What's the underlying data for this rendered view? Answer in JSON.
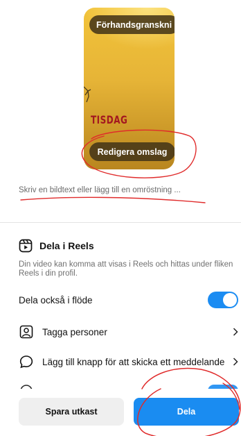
{
  "cover": {
    "preview_label": "Förhandsgranskni",
    "overlay_text": "TISDAG",
    "edit_label": "Redigera omslag"
  },
  "caption": {
    "placeholder": "Skriv en bildtext eller lägg till en omröstning ..."
  },
  "reels": {
    "title": "Dela i Reels",
    "description": "Din video kan komma att visas i Reels och hittas under fliken Reels i din profil."
  },
  "options": {
    "share_feed": {
      "label": "Dela också i flöde",
      "enabled": true
    },
    "tag_people": {
      "label": "Tagga personer",
      "icon": "tag-person-icon"
    },
    "message_button": {
      "label": "Lägg till knapp för att skicka ett meddelande",
      "icon": "message-bubble-icon"
    }
  },
  "actions": {
    "save_draft": "Spara utkast",
    "share": "Dela"
  },
  "colors": {
    "accent": "#1a8cf1",
    "annotation": "#e02b2b",
    "cover_gold": "#e6b437"
  }
}
